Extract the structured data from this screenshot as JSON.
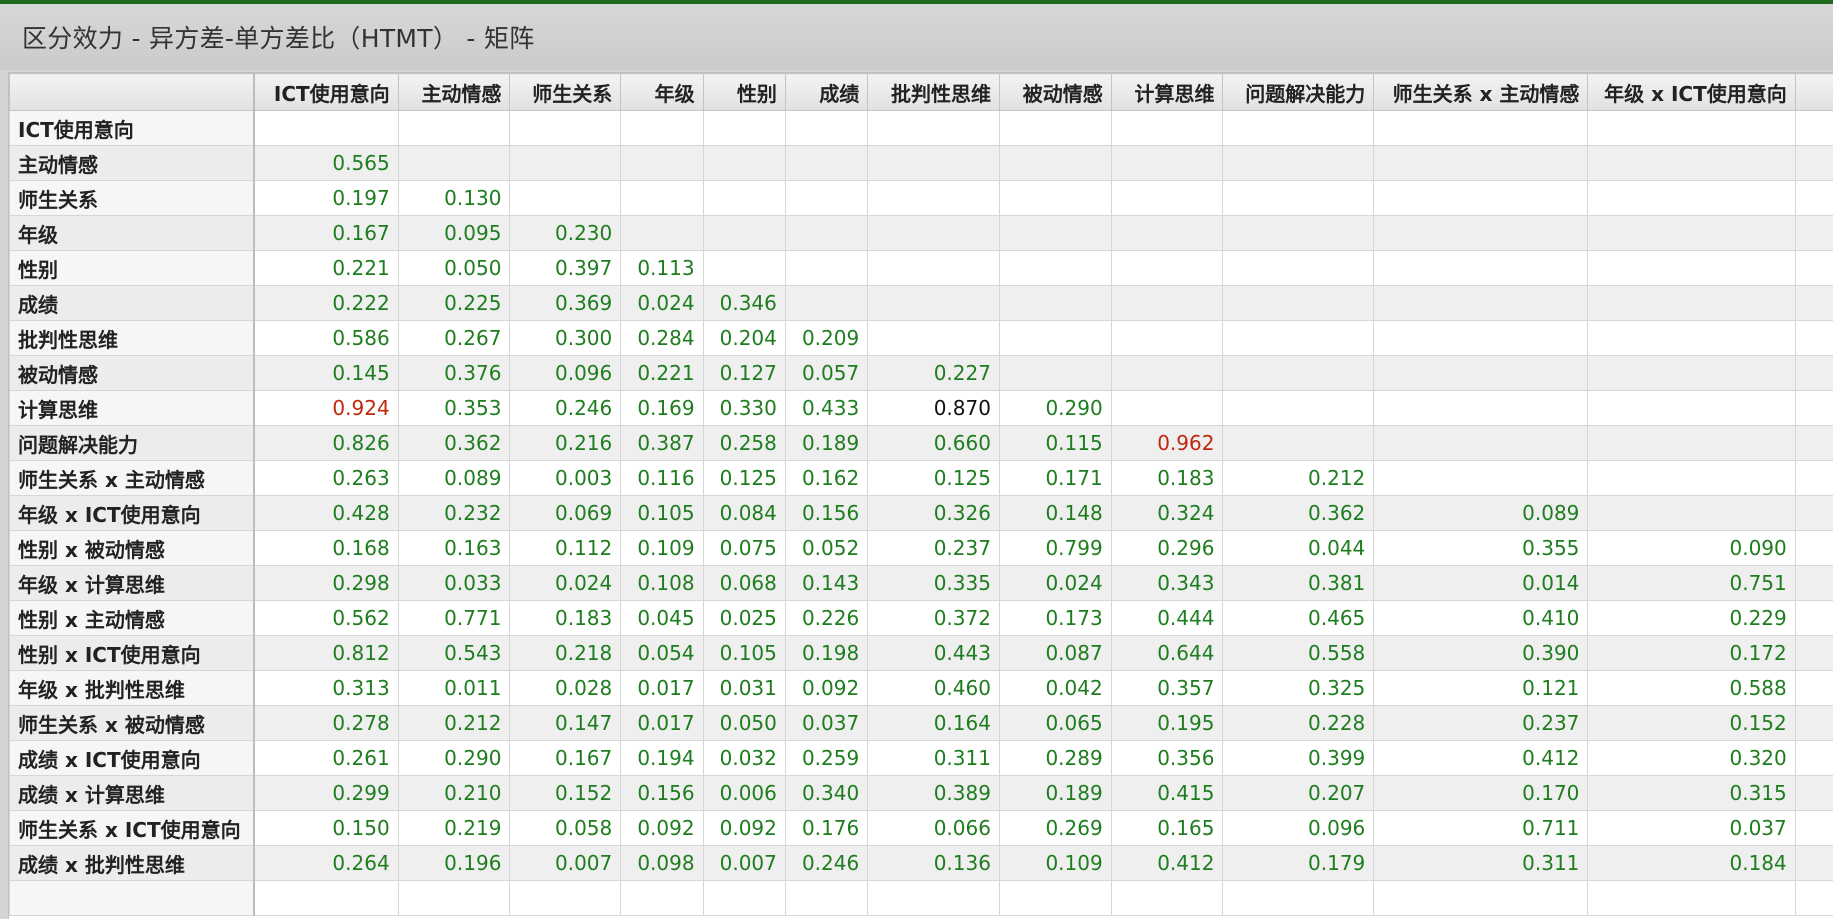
{
  "title": "区分效力 - 异方差-单方差比（HTMT） - 矩阵",
  "colors": {
    "normal": "#1e7d1e",
    "exceeds_threshold": "#c0270c",
    "borderline": "#111111"
  },
  "columns": [
    "ICT使用意向",
    "主动情感",
    "师生关系",
    "年级",
    "性别",
    "成绩",
    "批判性思维",
    "被动情感",
    "计算思维",
    "问题解决能力",
    "师生关系 x 主动情感",
    "年级 x ICT使用意向"
  ],
  "rows": [
    {
      "label": "ICT使用意向",
      "values": []
    },
    {
      "label": "主动情感",
      "values": [
        "0.565"
      ]
    },
    {
      "label": "师生关系",
      "values": [
        "0.197",
        "0.130"
      ]
    },
    {
      "label": "年级",
      "values": [
        "0.167",
        "0.095",
        "0.230"
      ]
    },
    {
      "label": "性别",
      "values": [
        "0.221",
        "0.050",
        "0.397",
        "0.113"
      ]
    },
    {
      "label": "成绩",
      "values": [
        "0.222",
        "0.225",
        "0.369",
        "0.024",
        "0.346"
      ]
    },
    {
      "label": "批判性思维",
      "values": [
        "0.586",
        "0.267",
        "0.300",
        "0.284",
        "0.204",
        "0.209"
      ]
    },
    {
      "label": "被动情感",
      "values": [
        "0.145",
        "0.376",
        "0.096",
        "0.221",
        "0.127",
        "0.057",
        "0.227"
      ]
    },
    {
      "label": "计算思维",
      "values": [
        "0.924",
        "0.353",
        "0.246",
        "0.169",
        "0.330",
        "0.433",
        "0.870",
        "0.290"
      ]
    },
    {
      "label": "问题解决能力",
      "values": [
        "0.826",
        "0.362",
        "0.216",
        "0.387",
        "0.258",
        "0.189",
        "0.660",
        "0.115",
        "0.962"
      ]
    },
    {
      "label": "师生关系 x 主动情感",
      "values": [
        "0.263",
        "0.089",
        "0.003",
        "0.116",
        "0.125",
        "0.162",
        "0.125",
        "0.171",
        "0.183",
        "0.212"
      ]
    },
    {
      "label": "年级 x ICT使用意向",
      "values": [
        "0.428",
        "0.232",
        "0.069",
        "0.105",
        "0.084",
        "0.156",
        "0.326",
        "0.148",
        "0.324",
        "0.362",
        "0.089"
      ]
    },
    {
      "label": "性别 x 被动情感",
      "values": [
        "0.168",
        "0.163",
        "0.112",
        "0.109",
        "0.075",
        "0.052",
        "0.237",
        "0.799",
        "0.296",
        "0.044",
        "0.355",
        "0.090"
      ]
    },
    {
      "label": "年级 x 计算思维",
      "values": [
        "0.298",
        "0.033",
        "0.024",
        "0.108",
        "0.068",
        "0.143",
        "0.335",
        "0.024",
        "0.343",
        "0.381",
        "0.014",
        "0.751"
      ]
    },
    {
      "label": "性别 x 主动情感",
      "values": [
        "0.562",
        "0.771",
        "0.183",
        "0.045",
        "0.025",
        "0.226",
        "0.372",
        "0.173",
        "0.444",
        "0.465",
        "0.410",
        "0.229"
      ]
    },
    {
      "label": "性别 x ICT使用意向",
      "values": [
        "0.812",
        "0.543",
        "0.218",
        "0.054",
        "0.105",
        "0.198",
        "0.443",
        "0.087",
        "0.644",
        "0.558",
        "0.390",
        "0.172"
      ]
    },
    {
      "label": "年级 x 批判性思维",
      "values": [
        "0.313",
        "0.011",
        "0.028",
        "0.017",
        "0.031",
        "0.092",
        "0.460",
        "0.042",
        "0.357",
        "0.325",
        "0.121",
        "0.588"
      ]
    },
    {
      "label": "师生关系 x 被动情感",
      "values": [
        "0.278",
        "0.212",
        "0.147",
        "0.017",
        "0.050",
        "0.037",
        "0.164",
        "0.065",
        "0.195",
        "0.228",
        "0.237",
        "0.152"
      ]
    },
    {
      "label": "成绩 x ICT使用意向",
      "values": [
        "0.261",
        "0.290",
        "0.167",
        "0.194",
        "0.032",
        "0.259",
        "0.311",
        "0.289",
        "0.356",
        "0.399",
        "0.412",
        "0.320"
      ]
    },
    {
      "label": "成绩 x 计算思维",
      "values": [
        "0.299",
        "0.210",
        "0.152",
        "0.156",
        "0.006",
        "0.340",
        "0.389",
        "0.189",
        "0.415",
        "0.207",
        "0.170",
        "0.315"
      ]
    },
    {
      "label": "师生关系 x ICT使用意向",
      "values": [
        "0.150",
        "0.219",
        "0.058",
        "0.092",
        "0.092",
        "0.176",
        "0.066",
        "0.269",
        "0.165",
        "0.096",
        "0.711",
        "0.037"
      ]
    },
    {
      "label": "成绩 x 批判性思维",
      "values": [
        "0.264",
        "0.196",
        "0.007",
        "0.098",
        "0.007",
        "0.246",
        "0.136",
        "0.109",
        "0.412",
        "0.179",
        "0.311",
        "0.184"
      ]
    },
    {
      "label": "",
      "values": []
    }
  ],
  "highlight_red": [
    [
      8,
      0
    ],
    [
      9,
      8
    ]
  ],
  "highlight_black": [
    [
      8,
      6
    ]
  ]
}
